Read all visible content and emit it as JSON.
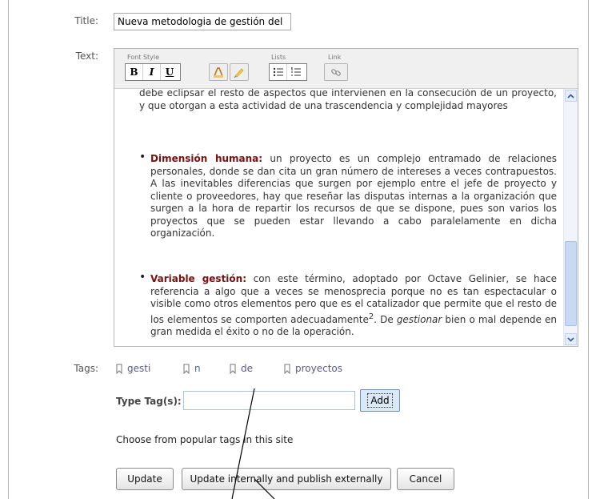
{
  "form": {
    "title_label": "Title:",
    "title_value": "Nueva metodologia de gestión del",
    "text_label": "Text:",
    "tags_label": "Tags:"
  },
  "toolbar": {
    "font_style_label": "Font Style",
    "lists_label": "Lists",
    "link_label": "Link",
    "bold": "B",
    "italic": "I",
    "underline": "U"
  },
  "content": {
    "intro": "debe eclipsar el resto de aspectos que intervienen en la consecución de un proyecto, y que otorgan a esta actividad de una trascendencia y complejidad mayores",
    "item1_term": "Dimensión humana:",
    "item1_text": " un proyecto es un complejo entramado de relaciones personales, donde se dan cita un gran número de intereses a veces contrapuestos. A las inevitables diferencias que surgen por ejemplo entre el jefe de proyecto y cliente o proveedores, hay que reseñar las disputas internas a la organización que surgen a la hora de repartir los recursos de que se dispone, pues son varios los proyectos que se pueden estar llevando a cabo paralelamente en dicha organización.",
    "item2_term": "Variable gestión:",
    "item2_text_a": " con este término, adoptado por Octave Gelinier, se hace referencia a algo que a veces se menosprecia porque no es tan espectacular o visible como otros elementos pero que es el catalizador que permite que el resto de los elementos se comporten adecuadamente",
    "item2_sup": "2",
    "item2_text_b": ". De ",
    "item2_em": "gestionar",
    "item2_text_c": " bien o mal depende en gran medida el éxito o no de la operación."
  },
  "tags": [
    "gesti",
    "n",
    "de",
    "proyectos"
  ],
  "tag_entry": {
    "label": "Type Tag(s):",
    "value": "",
    "add_label": "Add"
  },
  "popular_text": "Choose from popular tags in this site",
  "buttons": {
    "update": "Update",
    "publish": "Update internally and publish externally",
    "cancel": "Cancel"
  },
  "colors": {
    "term": "#7a1010",
    "tag_link": "#5b5b8f",
    "scrollbar": "#c9d9f4"
  }
}
